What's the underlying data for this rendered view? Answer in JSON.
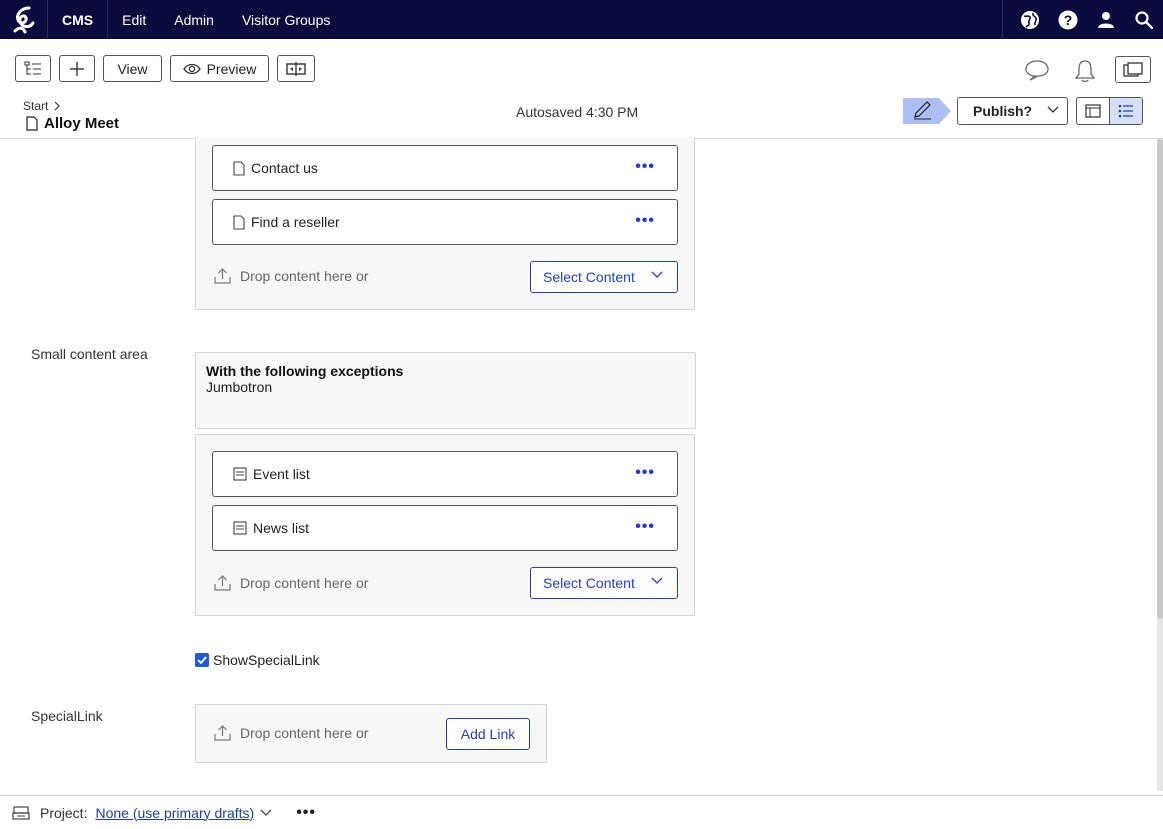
{
  "topnav": {
    "items": [
      "CMS",
      "Edit",
      "Admin",
      "Visitor Groups"
    ],
    "icons": [
      "globe-icon",
      "help-icon",
      "user-icon",
      "search-icon"
    ]
  },
  "toolbar": {
    "view_label": "View",
    "preview_label": "Preview"
  },
  "breadcrumb": {
    "start": "Start"
  },
  "page": {
    "title": "Alloy Meet",
    "autosaved": "Autosaved 4:30 PM"
  },
  "publish": {
    "label": "Publish?"
  },
  "content_area_top": {
    "items": [
      {
        "label": "Contact us",
        "icon": "page-icon"
      },
      {
        "label": "Find a reseller",
        "icon": "page-icon"
      }
    ],
    "drop_text": "Drop content here or",
    "select_label": "Select Content"
  },
  "small_content_area": {
    "label": "Small content area",
    "exceptions_heading": "With the following exceptions",
    "exceptions_text": "Jumbotron",
    "items": [
      {
        "label": "Event list",
        "icon": "block-icon"
      },
      {
        "label": "News list",
        "icon": "block-icon"
      }
    ],
    "drop_text": "Drop content here or",
    "select_label": "Select Content"
  },
  "show_special_link": {
    "label": "ShowSpecialLink",
    "checked": true
  },
  "special_link": {
    "label": "SpecialLink",
    "drop_text": "Drop content here or",
    "add_label": "Add Link"
  },
  "footer": {
    "project_label": "Project:",
    "project_value": "None (use primary drafts)"
  },
  "colors": {
    "nav_bg": "#0b0b3d",
    "accent": "#1f3fc7",
    "checkbox": "#1f5bd8"
  }
}
